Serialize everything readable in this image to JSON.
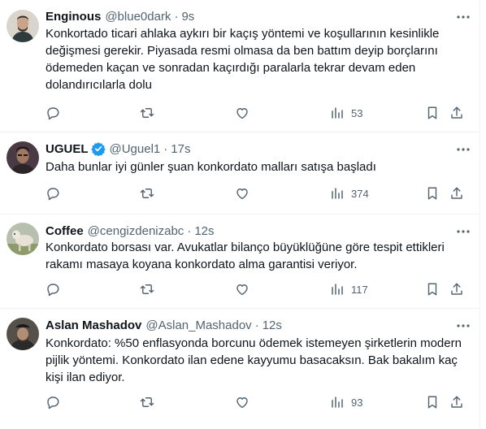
{
  "tweets": [
    {
      "name": "Enginous",
      "handle": "@blue0dark",
      "time": "9s",
      "verified": false,
      "text": "Konkortado ticari ahlaka aykırı bir kaçış yöntemi ve koşullarının kesinlikle değişmesi gerekir. Piyasada resmi olmasa da ben battım deyip borçlarını ödemeden kaçan ve sonradan kaçırdığı paralarla tekrar devam eden dolandırıcılarla dolu",
      "views": "53"
    },
    {
      "name": "UGUEL",
      "handle": "@Uguel1",
      "time": "17s",
      "verified": true,
      "text": "Daha bunlar iyi günler şuan konkordato malları satışa başladı",
      "views": "374"
    },
    {
      "name": "Coffee",
      "handle": "@cengizdenizabc",
      "time": "12s",
      "verified": false,
      "text": "Konkordato borsası var. Avukatlar bilanço büyüklüğüne göre tespit ettikleri rakamı masaya koyana konkordato alma garantisi veriyor.",
      "views": "117"
    },
    {
      "name": "Aslan Mashadov",
      "handle": "@Aslan_Mashadov",
      "time": "12s",
      "verified": false,
      "text": "Konkordato: %50 enflasyonda borcunu ödemek istemeyen şirketlerin modern pijlik yöntemi. Konkordato ilan edene kayyumu basacaksın. Bak bakalım kaç kişi ilan ediyor.",
      "views": "93"
    }
  ],
  "separator": "·",
  "colors": {
    "text": "#0f1419",
    "muted": "#536471",
    "border": "#eff3f4",
    "verified": "#1d9bf0"
  },
  "icons": [
    "more-icon",
    "reply-icon",
    "retweet-icon",
    "like-icon",
    "views-icon",
    "bookmark-icon",
    "share-icon",
    "verified-badge-icon"
  ]
}
